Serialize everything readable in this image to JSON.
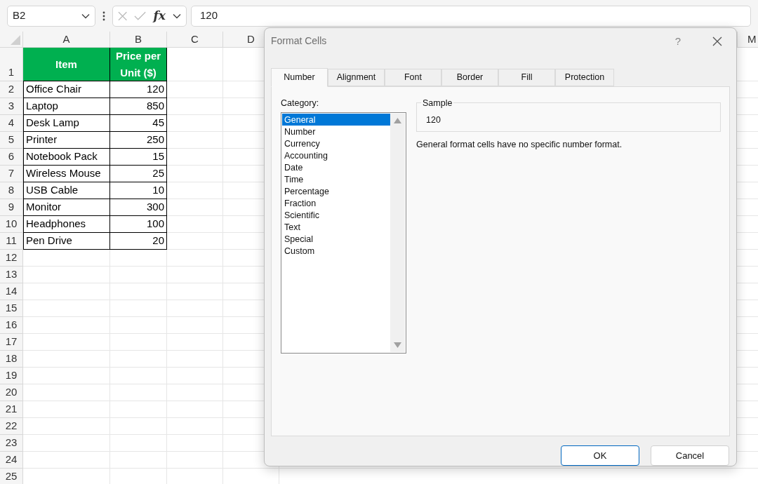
{
  "formula_bar": {
    "name_box": "B2",
    "fx": "fx",
    "value": "120"
  },
  "columns": [
    "A",
    "B",
    "C",
    "D",
    "M"
  ],
  "rows": [
    {
      "number": "1",
      "kind": "header",
      "cells": [
        "Item",
        "Price per Unit ($)"
      ]
    },
    {
      "number": "2",
      "kind": "data",
      "cells": [
        "Office Chair",
        "120"
      ]
    },
    {
      "number": "3",
      "kind": "data",
      "cells": [
        "Laptop",
        "850"
      ]
    },
    {
      "number": "4",
      "kind": "data",
      "cells": [
        "Desk Lamp",
        "45"
      ]
    },
    {
      "number": "5",
      "kind": "data",
      "cells": [
        "Printer",
        "250"
      ]
    },
    {
      "number": "6",
      "kind": "data",
      "cells": [
        "Notebook Pack",
        "15"
      ]
    },
    {
      "number": "7",
      "kind": "data",
      "cells": [
        "Wireless Mouse",
        "25"
      ]
    },
    {
      "number": "8",
      "kind": "data",
      "cells": [
        "USB Cable",
        "10"
      ]
    },
    {
      "number": "9",
      "kind": "data",
      "cells": [
        "Monitor",
        "300"
      ]
    },
    {
      "number": "10",
      "kind": "data",
      "cells": [
        "Headphones",
        "100"
      ]
    },
    {
      "number": "11",
      "kind": "data",
      "cells": [
        "Pen Drive",
        "20"
      ]
    },
    {
      "number": "12",
      "kind": "empty"
    },
    {
      "number": "13",
      "kind": "empty"
    },
    {
      "number": "14",
      "kind": "empty"
    },
    {
      "number": "15",
      "kind": "empty"
    },
    {
      "number": "16",
      "kind": "empty"
    },
    {
      "number": "17",
      "kind": "empty"
    },
    {
      "number": "18",
      "kind": "empty"
    },
    {
      "number": "19",
      "kind": "empty"
    },
    {
      "number": "20",
      "kind": "empty"
    },
    {
      "number": "21",
      "kind": "empty"
    },
    {
      "number": "22",
      "kind": "empty"
    },
    {
      "number": "23",
      "kind": "empty"
    },
    {
      "number": "24",
      "kind": "empty"
    },
    {
      "number": "25",
      "kind": "empty"
    }
  ],
  "dialog": {
    "title": "Format Cells",
    "help": "?",
    "tabs": [
      {
        "label": "Number",
        "selected": true
      },
      {
        "label": "Alignment",
        "selected": false
      },
      {
        "label": "Font",
        "selected": false
      },
      {
        "label": "Border",
        "selected": false
      },
      {
        "label": "Fill",
        "selected": false
      },
      {
        "label": "Protection",
        "selected": false
      }
    ],
    "category_label": "Category:",
    "categories": [
      {
        "label": "General",
        "selected": true
      },
      {
        "label": "Number",
        "selected": false
      },
      {
        "label": "Currency",
        "selected": false
      },
      {
        "label": "Accounting",
        "selected": false
      },
      {
        "label": "Date",
        "selected": false
      },
      {
        "label": "Time",
        "selected": false
      },
      {
        "label": "Percentage",
        "selected": false
      },
      {
        "label": "Fraction",
        "selected": false
      },
      {
        "label": "Scientific",
        "selected": false
      },
      {
        "label": "Text",
        "selected": false
      },
      {
        "label": "Special",
        "selected": false
      },
      {
        "label": "Custom",
        "selected": false
      }
    ],
    "sample_label": "Sample",
    "sample_value": "120",
    "description": "General format cells have no specific number format.",
    "buttons": [
      {
        "label": "OK",
        "kind": "default"
      },
      {
        "label": "Cancel",
        "kind": "normal"
      }
    ]
  }
}
